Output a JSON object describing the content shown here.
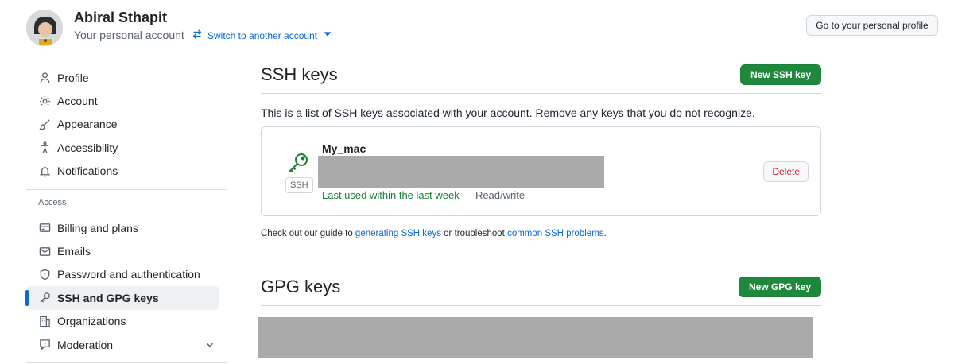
{
  "header": {
    "user_name": "Abiral Sthapit",
    "account_type": "Your personal account",
    "switch_label": "Switch to another account",
    "profile_button": "Go to your personal profile"
  },
  "sidebar": {
    "items": [
      {
        "label": "Profile",
        "icon": "person-icon"
      },
      {
        "label": "Account",
        "icon": "gear-icon"
      },
      {
        "label": "Appearance",
        "icon": "paintbrush-icon"
      },
      {
        "label": "Accessibility",
        "icon": "accessibility-icon"
      },
      {
        "label": "Notifications",
        "icon": "bell-icon"
      }
    ],
    "access_heading": "Access",
    "access_items": [
      {
        "label": "Billing and plans",
        "icon": "credit-card-icon"
      },
      {
        "label": "Emails",
        "icon": "mail-icon"
      },
      {
        "label": "Password and authentication",
        "icon": "shield-icon"
      },
      {
        "label": "SSH and GPG keys",
        "icon": "key-icon",
        "active": true
      },
      {
        "label": "Organizations",
        "icon": "organization-icon"
      },
      {
        "label": "Moderation",
        "icon": "report-icon"
      }
    ]
  },
  "ssh": {
    "title": "SSH keys",
    "new_button": "New SSH key",
    "description": "This is a list of SSH keys associated with your account. Remove any keys that you do not recognize.",
    "key": {
      "name": "My_mac",
      "badge": "SSH",
      "last_used": "Last used within the last week",
      "access": " — Read/write",
      "delete_button": "Delete"
    },
    "guide_prefix": "Check out our guide to ",
    "guide_link1": "generating SSH keys",
    "guide_middle": " or troubleshoot ",
    "guide_link2": "common SSH problems",
    "guide_suffix": "."
  },
  "gpg": {
    "title": "GPG keys",
    "new_button": "New GPG key"
  },
  "colors": {
    "accent": "#0969da",
    "primary_button": "#1f883d",
    "danger": "#cf222e",
    "success": "#1a7f37"
  }
}
